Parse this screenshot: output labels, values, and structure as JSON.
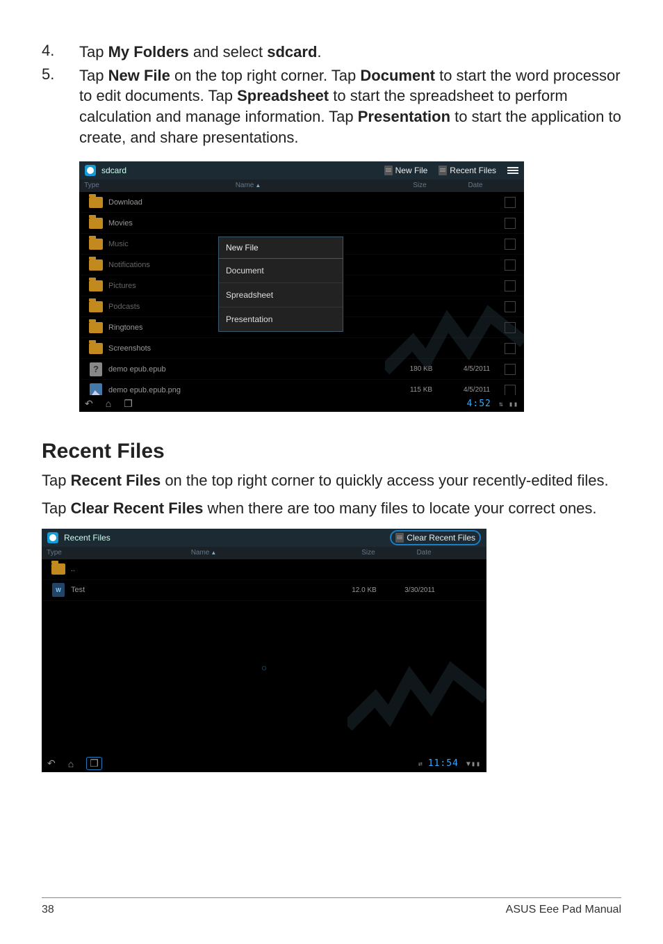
{
  "steps": {
    "s4": {
      "num": "4.",
      "pre": "Tap ",
      "b1": "My Folders",
      "mid": " and select ",
      "b2": "sdcard",
      "post": "."
    },
    "s5": {
      "num": "5.",
      "t1": "Tap ",
      "b1": "New File",
      "t2": " on the top right corner. Tap ",
      "b2": "Document",
      "t3": " to start the word processor to edit documents. Tap ",
      "b3": "Spreadsheet",
      "t4": " to start the spreadsheet to perform calculation and manage information. Tap ",
      "b4": "Presentation",
      "t5": " to start the application to create, and share presentations."
    }
  },
  "ss1": {
    "title": "sdcard",
    "new_file": "New File",
    "recent_files": "Recent Files",
    "headers": {
      "type": "Type",
      "name": "Name",
      "sort": "▲",
      "size": "Size",
      "date": "Date"
    },
    "rows": [
      {
        "name": "Download",
        "kind": "folder"
      },
      {
        "name": "Movies",
        "kind": "folder"
      },
      {
        "name": "Music",
        "kind": "folder"
      },
      {
        "name": "Notifications",
        "kind": "folder"
      },
      {
        "name": "Pictures",
        "kind": "folder"
      },
      {
        "name": "Podcasts",
        "kind": "folder"
      },
      {
        "name": "Ringtones",
        "kind": "folder"
      },
      {
        "name": "Screenshots",
        "kind": "folder"
      },
      {
        "name": "demo epub.epub",
        "kind": "unknown",
        "size": "180 KB",
        "date": "4/5/2011"
      },
      {
        "name": "demo epub.epub.png",
        "kind": "img",
        "size": "115 KB",
        "date": "4/5/2011"
      }
    ],
    "popup": {
      "title": "New File",
      "items": [
        "Document",
        "Spreadsheet",
        "Presentation"
      ]
    },
    "clock": "4:52"
  },
  "section2": {
    "title": "Recent Files",
    "p1": {
      "t1": "Tap ",
      "b1": "Recent Files",
      "t2": " on the top right corner to quickly access your recently-edited files."
    },
    "p2": {
      "t1": "Tap ",
      "b1": "Clear Recent Files",
      "t2": " when there are too many files to locate your correct ones."
    }
  },
  "ss2": {
    "title": "Recent Files",
    "clear": "Clear Recent Files",
    "headers": {
      "type": "Type",
      "name": "Name",
      "sort": "▲",
      "size": "Size",
      "date": "Date"
    },
    "rows": [
      {
        "name": "..",
        "kind": "up"
      },
      {
        "name": "Test",
        "kind": "doc",
        "size": "12.0 KB",
        "date": "3/30/2011"
      }
    ],
    "clock": "11:54"
  },
  "footer": {
    "page": "38",
    "manual": "ASUS Eee Pad Manual"
  }
}
